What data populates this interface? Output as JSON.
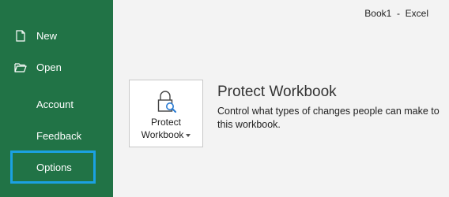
{
  "window": {
    "doc_name": "Book1",
    "separator": "-",
    "app_name": "Excel"
  },
  "sidebar": {
    "items": [
      {
        "label": "New",
        "icon": "new-document-icon"
      },
      {
        "label": "Open",
        "icon": "folder-open-icon"
      },
      {
        "label": "Account"
      },
      {
        "label": "Feedback"
      },
      {
        "label": "Options",
        "highlighted": true
      }
    ]
  },
  "protect": {
    "button_line1": "Protect",
    "button_line2": "Workbook",
    "heading": "Protect Workbook",
    "description": "Control what types of changes people can make to this workbook."
  },
  "colors": {
    "sidebar_bg": "#217346",
    "highlight_border": "#1ba1e2",
    "content_bg": "#f3f3f3"
  }
}
